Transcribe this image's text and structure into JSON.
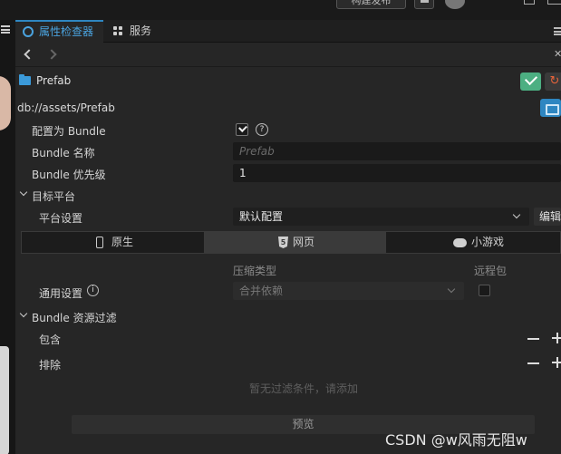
{
  "top": {
    "build_button_label": "构建发布"
  },
  "tabs": [
    {
      "label": "属性检查器",
      "icon": "inspector-icon",
      "active": true
    },
    {
      "label": "服务",
      "icon": "grid-icon",
      "active": false
    }
  ],
  "asset": {
    "name": "Prefab",
    "path": "db://assets/Prefab"
  },
  "bundle": {
    "config_label": "配置为 Bundle",
    "config_checked": true,
    "name_label": "Bundle 名称",
    "name_placeholder": "Prefab",
    "priority_label": "Bundle 优先级",
    "priority_value": "1"
  },
  "target_platform": {
    "section_label": "目标平台",
    "platform_setting_label": "平台设置",
    "platform_setting_value": "默认配置",
    "edit_label": "编辑"
  },
  "platform_tabs": [
    {
      "label": "原生",
      "icon": "phone-icon"
    },
    {
      "label": "网页",
      "icon": "html5-icon",
      "active": true
    },
    {
      "label": "小游戏",
      "icon": "gamepad-icon"
    }
  ],
  "general": {
    "compression_header": "压缩类型",
    "remote_header": "远程包",
    "label": "通用设置",
    "compression_value": "合并依赖",
    "remote_checked": false
  },
  "filter": {
    "section_label": "Bundle 资源过滤",
    "include_label": "包含",
    "exclude_label": "排除",
    "empty_text": "暂无过滤条件，请添加",
    "preview_label": "预览"
  },
  "watermark": "CSDN @w风雨无阻w",
  "colors": {
    "accent": "#2e86c1",
    "apply_green": "#4caf82",
    "revert_orange": "#e8643a"
  }
}
